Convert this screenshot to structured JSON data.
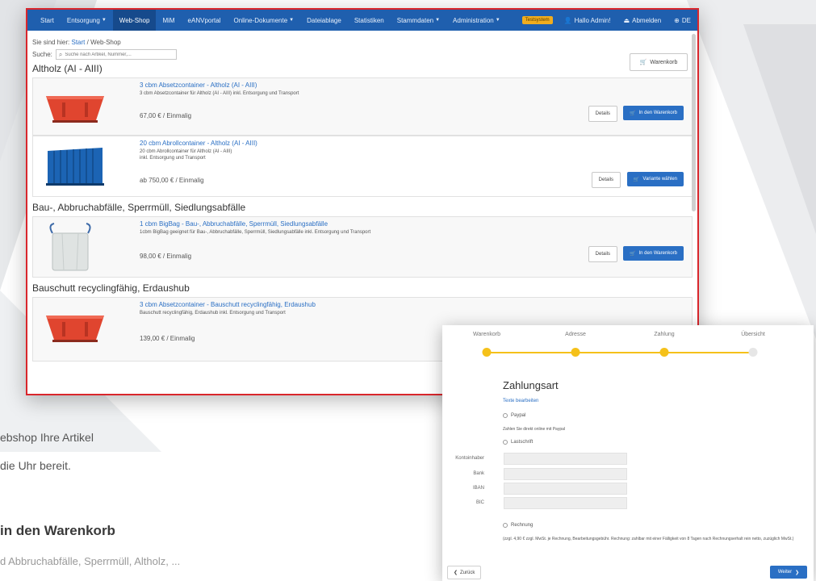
{
  "nav": {
    "items": [
      {
        "label": "Start"
      },
      {
        "label": "Entsorgung",
        "dropdown": true
      },
      {
        "label": "Web-Shop",
        "active": true
      },
      {
        "label": "MiM"
      },
      {
        "label": "eANVportal"
      },
      {
        "label": "Online-Dokumente",
        "dropdown": true
      },
      {
        "label": "Dateiablage"
      },
      {
        "label": "Statistiken"
      },
      {
        "label": "Stammdaten",
        "dropdown": true
      },
      {
        "label": "Administration",
        "dropdown": true
      }
    ],
    "badge": "Testsystem",
    "user": "Hallo Admin!",
    "logout": "Abmelden",
    "language": "DE"
  },
  "breadcrumb": {
    "prefix": "Sie sind hier:",
    "start": "Start",
    "separator": "/",
    "current": "Web-Shop"
  },
  "search": {
    "label": "Suche:",
    "placeholder": "Suche nach Artikel, Nummer,..."
  },
  "cart_button": "Warenkorb",
  "categories": [
    {
      "title": "Altholz (AI - AIII)",
      "products": [
        {
          "title": "3 cbm Absetzcontainer - Altholz (AI - AIII)",
          "desc": "3 cbm Absetzcontainer für Altholz (AI - AIII) inkl. Entsorgung und Transport",
          "price": "67,00 € / Einmalig",
          "details": "Details",
          "action": "In den Warenkorb"
        },
        {
          "title": "20 cbm Abrollcontainer - Altholz (AI - AIII)",
          "desc": "20 cbm Abrollcontainer für Altholz (AI - AIII)",
          "desc2": "inkl. Entsorgung und Transport",
          "price": "ab 750,00 € / Einmalig",
          "details": "Details",
          "action": "Variante wählen"
        }
      ]
    },
    {
      "title": "Bau-, Abbruchabfälle, Sperrmüll, Siedlungsabfälle",
      "products": [
        {
          "title": "1 cbm BigBag - Bau-, Abbruchabfälle, Sperrmüll, Siedlungsabfälle",
          "desc": "1cbm BigBag geeignet für Bau-, Abbruchabfälle, Sperrmüll, Siedlungsabfälle inkl. Entsorgung und Transport",
          "price": "98,00 € / Einmalig",
          "details": "Details",
          "action": "In den Warenkorb"
        }
      ]
    },
    {
      "title": "Bauschutt recyclingfähig, Erdaushub",
      "products": [
        {
          "title": "3 cbm Absetzcontainer - Bauschutt recyclingfähig, Erdaushub",
          "desc": "Bauschutt recyclingfähig, Erdaushub inkl. Entsorgung und Transport",
          "price": "139,00 € / Einmalig"
        }
      ]
    }
  ],
  "checkout": {
    "steps": [
      {
        "label": "Warenkorb",
        "done": true
      },
      {
        "label": "Adresse",
        "done": true
      },
      {
        "label": "Zahlung",
        "done": true
      },
      {
        "label": "Übersicht",
        "done": false
      }
    ],
    "title": "Zahlungsart",
    "edit_link": "Texte bearbeiten",
    "options": {
      "paypal": {
        "label": "Paypal",
        "hint": "Zahlen Sie direkt online mit Paypal"
      },
      "lastschrift": {
        "label": "Lastschrift"
      },
      "rechnung": {
        "label": "Rechnung",
        "hint": "(zzgl. 4,90 € zzgl. MwSt. je Rechnung, Bearbeitungsgebühr. Rechnung: zahlbar mit einer Fälligkeit von 8 Tagen nach Rechnungserhalt rein netto, zuzüglich MwSt.)"
      }
    },
    "fields": [
      {
        "label": "Kontoinhaber"
      },
      {
        "label": "Bank"
      },
      {
        "label": "IBAN"
      },
      {
        "label": "BIC"
      }
    ],
    "back": "Zurück",
    "next": "Weiter"
  },
  "marketing": {
    "line1": "ebshop Ihre Artikel",
    "line2": "die Uhr bereit.",
    "heading": "in den Warenkorb",
    "line3": "d Abbruchabfälle, Sperrmüll, Altholz, ..."
  },
  "colors": {
    "nav": "#1f5fae",
    "primary": "#2a6fc4",
    "accent": "#f5c11a",
    "frame": "#d9262c",
    "container_red": "#e0452f",
    "container_blue": "#1c64b4"
  }
}
